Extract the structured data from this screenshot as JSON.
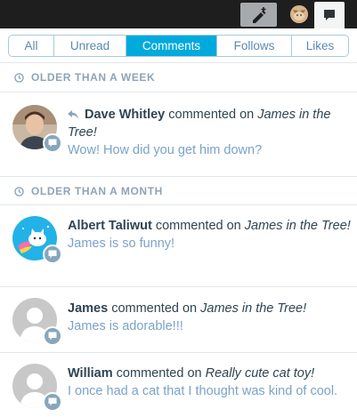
{
  "topbar": {
    "write_icon": "pencil-plus-icon",
    "avatar_icon": "cat-avatar",
    "notifications_icon": "speech-bubble-icon"
  },
  "tabs": [
    {
      "label": "All",
      "active": false
    },
    {
      "label": "Unread",
      "active": false
    },
    {
      "label": "Comments",
      "active": true
    },
    {
      "label": "Follows",
      "active": false
    },
    {
      "label": "Likes",
      "active": false
    }
  ],
  "sections": [
    {
      "label": "OLDER THAN A WEEK",
      "icon": "clock-icon"
    },
    {
      "label": "OLDER THAN A MONTH",
      "icon": "clock-icon"
    }
  ],
  "notes": [
    {
      "name": "Dave Whitley",
      "verb": "commented on",
      "post": "James in the Tree!",
      "excerpt": "Wow! How did you get him down?",
      "replied": true
    },
    {
      "name": "Albert Taliwut",
      "verb": "commented on",
      "post": "James in the Tree!",
      "excerpt": "James is so funny!"
    },
    {
      "name": "James",
      "verb": "commented on",
      "post": "James in the Tree!",
      "excerpt": "James is adorable!!!"
    },
    {
      "name": "William",
      "verb": "commented on",
      "post": "Really cute cat toy!",
      "excerpt": "I once had a cat that I thought was kind of cool."
    }
  ],
  "colors": {
    "accent": "#00aadc",
    "excerpt": "#7ba3c8",
    "section": "#8ea4b5",
    "badge": "#87a6bc"
  }
}
